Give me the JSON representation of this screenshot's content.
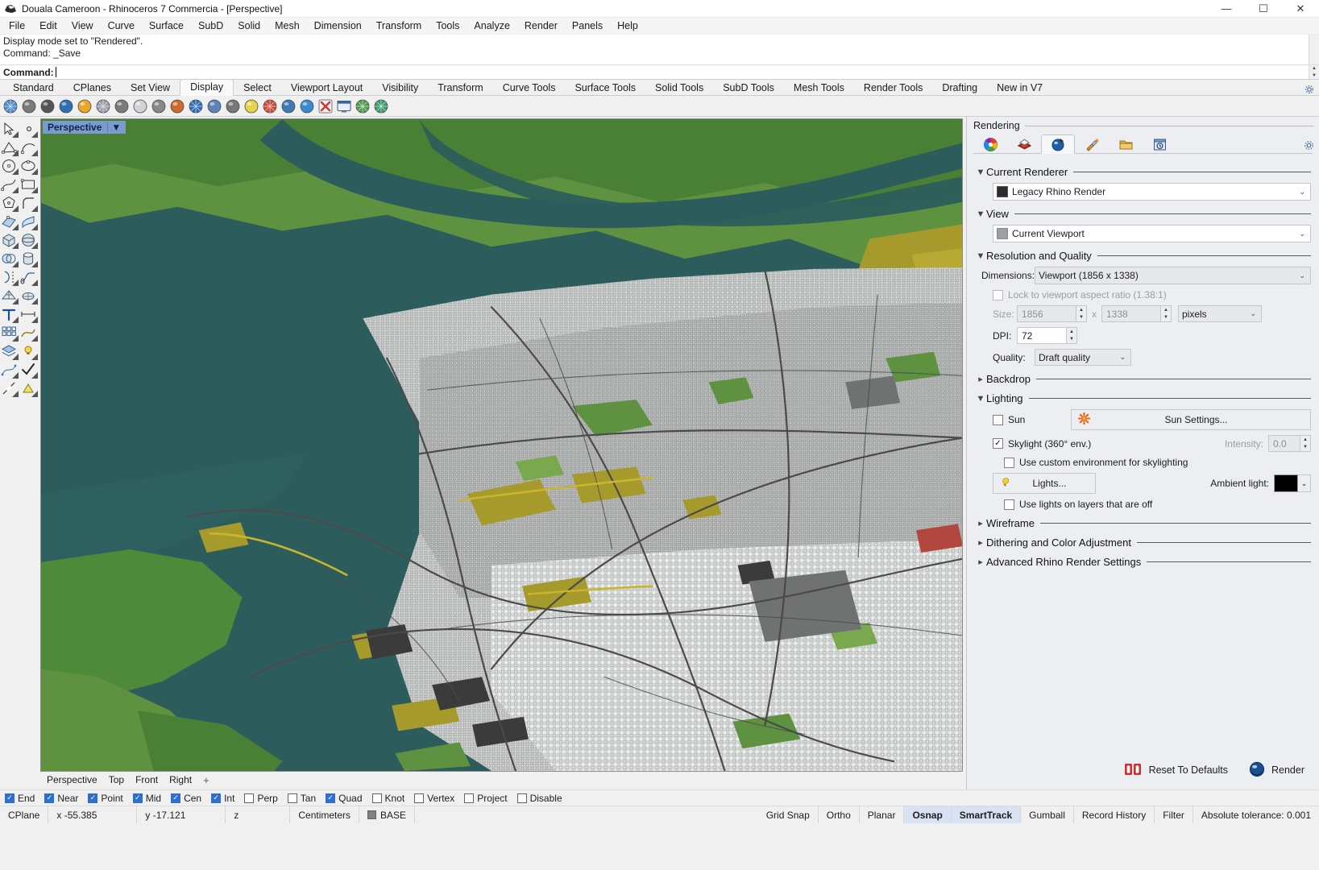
{
  "window": {
    "title": "Douala Cameroon - Rhinoceros 7 Commercia - [Perspective]",
    "icon": "rhino-logo-icon",
    "minimize": "—",
    "maximize": "☐",
    "close": "✕"
  },
  "menubar": {
    "items": [
      "File",
      "Edit",
      "View",
      "Curve",
      "Surface",
      "SubD",
      "Solid",
      "Mesh",
      "Dimension",
      "Transform",
      "Tools",
      "Analyze",
      "Render",
      "Panels",
      "Help"
    ]
  },
  "command": {
    "history": [
      "Display mode set to \"Rendered\".",
      "Command: _Save"
    ],
    "prompt_label": "Command:",
    "prompt_value": ""
  },
  "toolbar_tabs": {
    "items": [
      "Standard",
      "CPlanes",
      "Set View",
      "Display",
      "Select",
      "Viewport Layout",
      "Visibility",
      "Transform",
      "Curve Tools",
      "Surface Tools",
      "Solid Tools",
      "SubD Tools",
      "Mesh Tools",
      "Render Tools",
      "Drafting",
      "New in V7"
    ],
    "active": "Display"
  },
  "viewport": {
    "label": "Perspective",
    "dropdown_arrow": "▼",
    "tabs": [
      "Perspective",
      "Top",
      "Front",
      "Right"
    ],
    "active_tab": "Perspective",
    "add_tab": "+"
  },
  "rendering_panel": {
    "title": "Rendering",
    "tabs": [
      {
        "name": "materials-icon",
        "label": "Materials"
      },
      {
        "name": "environments-icon",
        "label": "Environments"
      },
      {
        "name": "rendering-icon",
        "label": "Rendering"
      },
      {
        "name": "ground-plane-icon",
        "label": "Ground Plane"
      },
      {
        "name": "folder-icon",
        "label": "Libraries"
      },
      {
        "name": "render-window-icon",
        "label": "Render Window"
      }
    ],
    "active_tab_index": 2,
    "gear_icon": "gear-icon",
    "current_renderer": {
      "section_title": "Current Renderer",
      "expanded": true,
      "value": "Legacy Rhino Render",
      "chevron": "⌄"
    },
    "view": {
      "section_title": "View",
      "expanded": true,
      "value": "Current Viewport",
      "chevron": "⌄"
    },
    "resolution": {
      "section_title": "Resolution and Quality",
      "expanded": true,
      "dimensions_label": "Dimensions:",
      "dimensions_value": "Viewport (1856 x 1338)",
      "lock_label": "Lock to viewport aspect ratio (1.38:1)",
      "lock_checked": false,
      "size_label": "Size:",
      "size_width": "1856",
      "size_x": "x",
      "size_height": "1338",
      "size_units": "pixels",
      "dpi_label": "DPI:",
      "dpi_value": "72",
      "quality_label": "Quality:",
      "quality_value": "Draft quality"
    },
    "backdrop": {
      "section_title": "Backdrop",
      "expanded": false
    },
    "lighting": {
      "section_title": "Lighting",
      "expanded": true,
      "sun_label": "Sun",
      "sun_checked": false,
      "sun_settings_button": "Sun Settings...",
      "skylight_label": "Skylight (360° env.)",
      "skylight_checked": true,
      "intensity_label": "Intensity:",
      "intensity_value": "0.0",
      "custom_env_label": "Use custom environment for skylighting",
      "custom_env_checked": false,
      "lights_button": "Lights...",
      "ambient_label": "Ambient light:",
      "ambient_color": "#000000",
      "lights_off_label": "Use lights on layers that are off",
      "lights_off_checked": false
    },
    "wireframe": {
      "section_title": "Wireframe",
      "expanded": false
    },
    "dithering": {
      "section_title": "Dithering and Color Adjustment",
      "expanded": false
    },
    "advanced": {
      "section_title": "Advanced Rhino Render Settings",
      "expanded": false
    },
    "footer": {
      "reset_label": "Reset To Defaults",
      "reset_icon": "reset-defaults-icon",
      "render_label": "Render",
      "render_icon": "render-sphere-icon"
    }
  },
  "osnap": {
    "items": [
      {
        "label": "End",
        "checked": true
      },
      {
        "label": "Near",
        "checked": true
      },
      {
        "label": "Point",
        "checked": true
      },
      {
        "label": "Mid",
        "checked": true
      },
      {
        "label": "Cen",
        "checked": true
      },
      {
        "label": "Int",
        "checked": true
      },
      {
        "label": "Perp",
        "checked": false
      },
      {
        "label": "Tan",
        "checked": false
      },
      {
        "label": "Quad",
        "checked": true
      },
      {
        "label": "Knot",
        "checked": false
      },
      {
        "label": "Vertex",
        "checked": false
      },
      {
        "label": "Project",
        "checked": false
      },
      {
        "label": "Disable",
        "checked": false
      }
    ]
  },
  "statusbar": {
    "cplane": "CPlane",
    "x": "x -55.385",
    "y": "y -17.121",
    "z": "z",
    "units": "Centimeters",
    "layer": "BASE",
    "layer_color": "#808080",
    "toggles": [
      {
        "label": "Grid Snap",
        "active": false
      },
      {
        "label": "Ortho",
        "active": false
      },
      {
        "label": "Planar",
        "active": false
      },
      {
        "label": "Osnap",
        "active": true
      },
      {
        "label": "SmartTrack",
        "active": true
      },
      {
        "label": "Gumball",
        "active": false
      },
      {
        "label": "Record History",
        "active": false
      },
      {
        "label": "Filter",
        "active": false
      }
    ],
    "tolerance": "Absolute tolerance: 0.001"
  }
}
